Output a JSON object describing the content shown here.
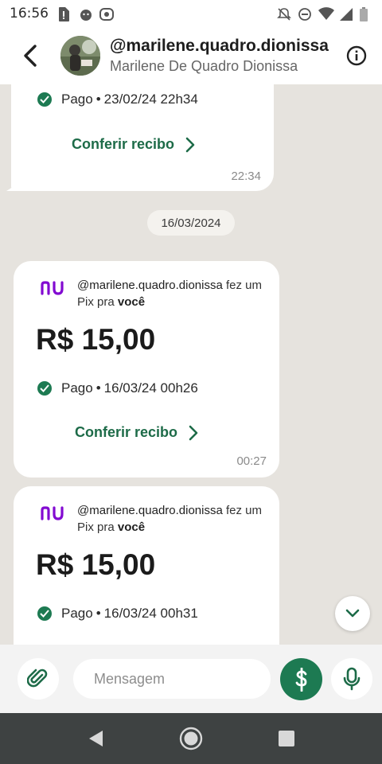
{
  "status_bar": {
    "time": "16:56",
    "left_icons": [
      "sim-alert-icon",
      "android-icon",
      "whatsapp-icon"
    ],
    "right_icons": [
      "muted-bell-icon",
      "dnd-icon",
      "wifi-icon",
      "signal-icon",
      "battery-icon"
    ]
  },
  "header": {
    "handle": "@marilene.quadro.dionissa",
    "name": "Marilene De Quadro Dionissa"
  },
  "chat": {
    "previous_message": {
      "status": "Pago",
      "datetime": "23/02/24 22h34",
      "receipt_label": "Conferir recibo",
      "time": "22:34"
    },
    "date_chip": "16/03/2024",
    "pix_messages": [
      {
        "handle": "@marilene.quadro.dionissa",
        "text_after_handle": " fez um Pix pra ",
        "recipient": "você",
        "amount": "R$ 15,00",
        "status": "Pago",
        "datetime": "16/03/24 00h26",
        "receipt_label": "Conferir recibo",
        "time": "00:27"
      },
      {
        "handle": "@marilene.quadro.dionissa",
        "text_after_handle": " fez um Pix pra ",
        "recipient": "você",
        "amount": "R$ 15,00",
        "status": "Pago",
        "datetime": "16/03/24 00h31"
      }
    ]
  },
  "composer": {
    "placeholder": "Mensagem"
  },
  "colors": {
    "brand_green": "#1d7a52",
    "nubank_purple": "#820ad1",
    "chat_background": "#e6e3de"
  }
}
